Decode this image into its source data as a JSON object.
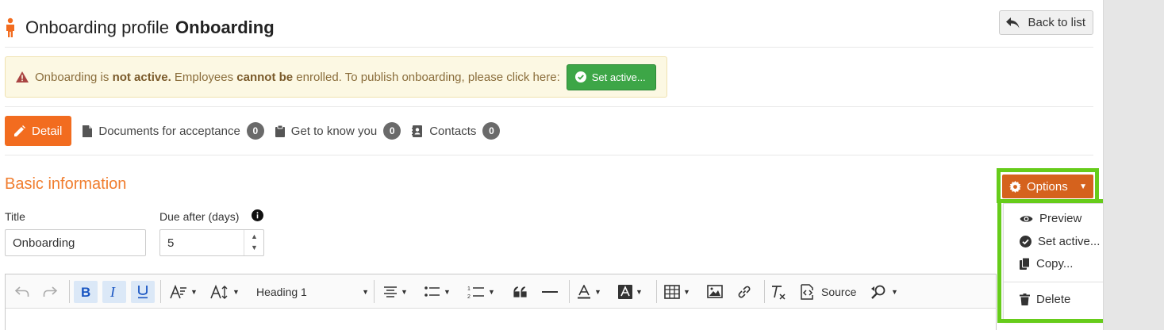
{
  "header": {
    "icon": "person-icon",
    "title_prefix": "Onboarding profile",
    "title_name": "Onboarding",
    "back_label": "Back to list"
  },
  "alert": {
    "part1": "Onboarding is ",
    "part2": "not active.",
    "part3": " Employees ",
    "part4": "cannot be",
    "part5": " enrolled. To publish onboarding, please click here:",
    "button_label": "Set active..."
  },
  "tabs": [
    {
      "label": "Detail",
      "icon": "pencil-icon"
    },
    {
      "label": "Documents for acceptance",
      "count": "0",
      "icon": "document-icon"
    },
    {
      "label": "Get to know you",
      "count": "0",
      "icon": "clipboard-icon"
    },
    {
      "label": "Contacts",
      "count": "0",
      "icon": "address-book-icon"
    }
  ],
  "section": {
    "title": "Basic information"
  },
  "options": {
    "label": "Options",
    "items": [
      {
        "label": "Preview",
        "icon": "eye-icon"
      },
      {
        "label": "Set active...",
        "icon": "check-circle-icon"
      },
      {
        "label": "Copy...",
        "icon": "copy-icon"
      },
      {
        "label": "Delete",
        "icon": "trash-icon"
      }
    ]
  },
  "form": {
    "title_label": "Title",
    "title_value": "Onboarding",
    "due_label": "Due after (days)",
    "due_value": "5"
  },
  "editor": {
    "heading_value": "Heading 1",
    "source_label": "Source"
  },
  "colors": {
    "accent_orange": "#f26c1f",
    "section_title": "#f07d2e",
    "options_button": "#d5621d",
    "success_green": "#3da647",
    "highlight_green": "#66cc1a",
    "alert_bg": "#fcf8e3"
  }
}
